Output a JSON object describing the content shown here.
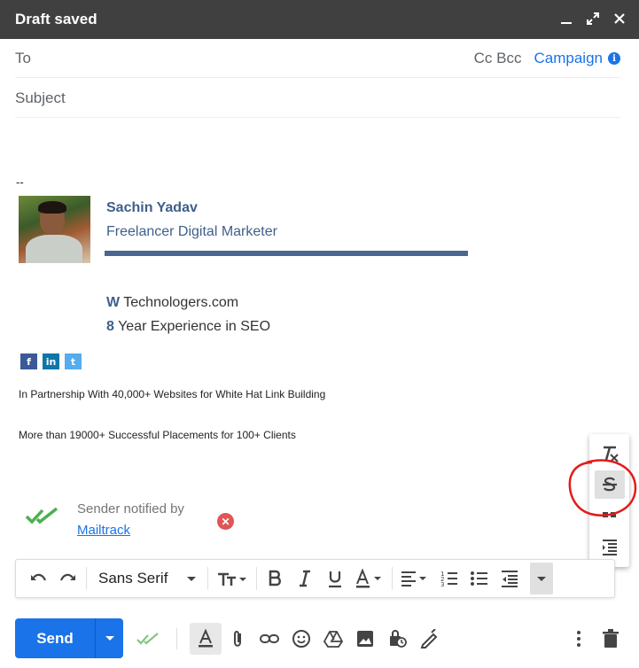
{
  "window": {
    "title": "Draft saved"
  },
  "to_row": {
    "label": "To",
    "cc_bcc": "Cc Bcc",
    "campaign": "Campaign"
  },
  "subject": {
    "placeholder": "Subject"
  },
  "signature": {
    "separator": "--",
    "name": "Sachin Yadav",
    "role": "Freelancer Digital Marketer",
    "website_prefix": "W",
    "website": "Technologers.com",
    "experience_prefix": "8",
    "experience": "Year Experience in SEO",
    "social": {
      "facebook": "f",
      "linkedin": "in",
      "twitter": "t"
    },
    "partnership": "In Partnership With 40,000+ Websites for White Hat Link Building",
    "placements": "More than 19000+ Successful Placements for 100+ Clients"
  },
  "mailtrack": {
    "text": "Sender notified by",
    "link": "Mailtrack"
  },
  "format_toolbar": {
    "font": "Sans Serif"
  },
  "bottom": {
    "send_label": "Send"
  },
  "colors": {
    "accent": "#1a73e8",
    "titlebar": "#404040",
    "signature_blue": "#3f5f8a",
    "mailtrack_green": "#4caf50",
    "annotation_red": "#e21b1b"
  }
}
